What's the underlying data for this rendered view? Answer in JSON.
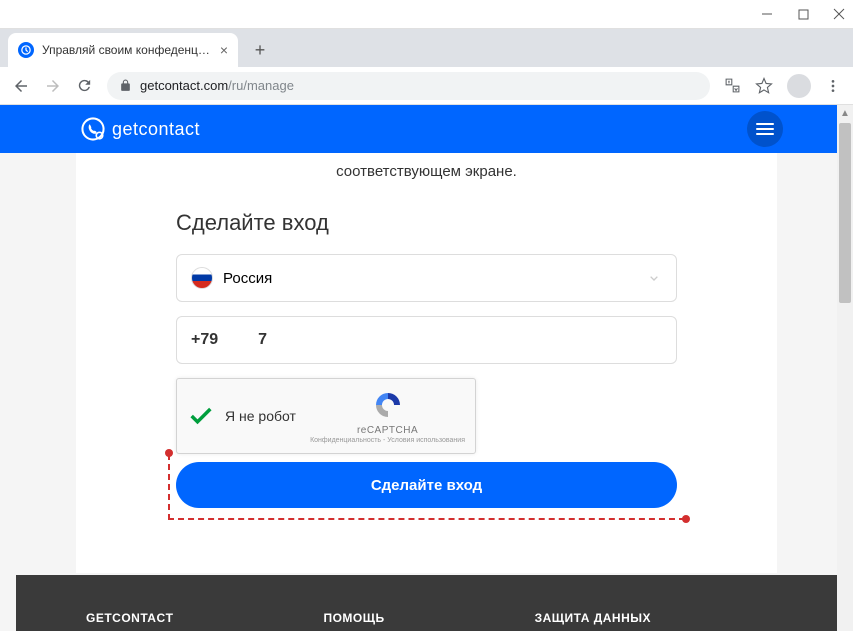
{
  "window": {
    "tab_title": "Управляй своим конфеденциал",
    "url_domain": "getcontact.com",
    "url_path": "/ru/manage"
  },
  "header": {
    "brand": "getcontact"
  },
  "content": {
    "subtitle": "соответствующем экране.",
    "heading": "Сделайте вход",
    "country": "Россия",
    "phone_prefix": "+79",
    "phone_suffix": "7",
    "recaptcha_label": "Я не робот",
    "recaptcha_brand": "reCAPTCHA",
    "recaptcha_links": "Конфиденциальность - Условия использования",
    "submit": "Сделайте вход"
  },
  "footer": {
    "col1": "GETCONTACT",
    "col2": "ПОМОЩЬ",
    "col3": "ЗАЩИТА ДАННЫХ"
  }
}
